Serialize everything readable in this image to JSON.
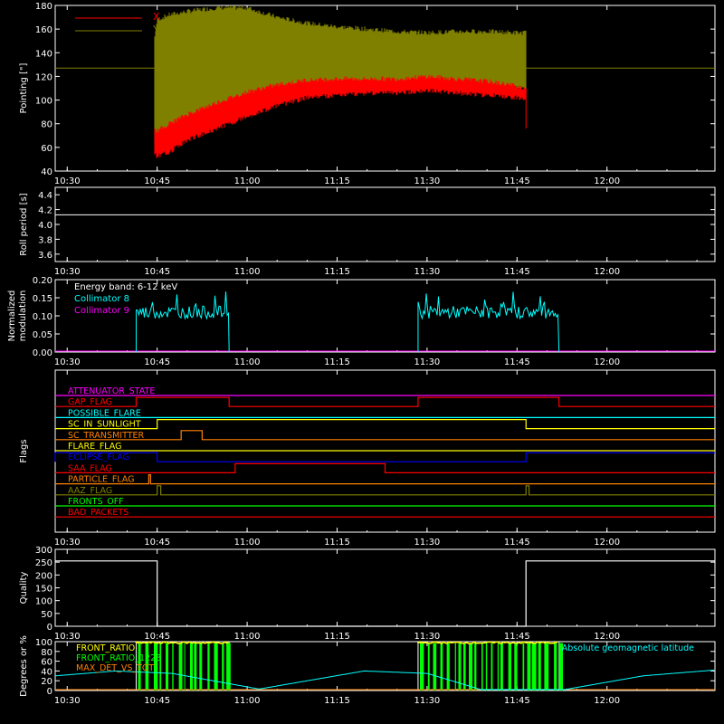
{
  "colors": {
    "background": "#000000",
    "axis": "#ffffff",
    "x_pointing": "#ff0000",
    "y_pointing": "#808000",
    "collimator8": "#00ffff",
    "collimator9": "#ff00ff",
    "quality": "#ffffff",
    "front_ratio": "#ffff00",
    "front_ratio_1223": "#00ff00",
    "max_det_vs_tot": "#ff8000",
    "geomag": "#00ffff"
  },
  "time_ticks": [
    "10:30",
    "10:45",
    "11:00",
    "11:15",
    "11:30",
    "11:45",
    "12:00"
  ],
  "time_tick_minutes": [
    630,
    645,
    660,
    675,
    690,
    705,
    720
  ],
  "time_range": [
    628,
    738
  ],
  "chart_data": [
    {
      "type": "area",
      "name": "pointing",
      "ylabel": "Pointing [\"]",
      "ylim": [
        40,
        180
      ],
      "yticks": [
        "40",
        "60",
        "80",
        "100",
        "120",
        "140",
        "160",
        "180"
      ],
      "legend": [
        "X",
        "Y"
      ],
      "legend_placement": "top-left",
      "active_range": [
        644.5,
        706.5
      ],
      "y_reference_line": 127,
      "series": [
        {
          "name": "Y",
          "x": [
            644.5,
            645,
            647,
            650,
            655,
            660,
            665,
            670,
            675,
            680,
            685,
            690,
            695,
            700,
            705,
            706.5
          ],
          "low": [
            68,
            60,
            68,
            78,
            88,
            97,
            104,
            110,
            112,
            114,
            114,
            116,
            114,
            114,
            112,
            112
          ],
          "high": [
            150,
            168,
            172,
            175,
            178,
            178,
            170,
            165,
            162,
            160,
            158,
            157,
            158,
            158,
            157,
            157
          ]
        },
        {
          "name": "X",
          "x": [
            644.5,
            645,
            647,
            650,
            655,
            660,
            665,
            670,
            675,
            680,
            685,
            690,
            695,
            700,
            705,
            706.5
          ],
          "low": [
            58,
            54,
            58,
            68,
            78,
            88,
            97,
            104,
            106,
            108,
            108,
            110,
            108,
            106,
            104,
            102
          ],
          "high": [
            75,
            74,
            80,
            88,
            98,
            107,
            113,
            117,
            118,
            118,
            118,
            120,
            118,
            116,
            112,
            110
          ]
        }
      ]
    },
    {
      "type": "line",
      "name": "roll_period",
      "ylabel": "Roll period [s]",
      "ylim": [
        3.5,
        4.5
      ],
      "yticks": [
        "3.6",
        "3.8",
        "4.0",
        "4.2",
        "4.4"
      ],
      "series": [
        {
          "name": "",
          "x": [
            628,
            738
          ],
          "values": [
            4.13,
            4.13
          ]
        }
      ]
    },
    {
      "type": "line",
      "name": "modulation",
      "ylabel": "Normalized modulation",
      "ylim": [
        0,
        0.2
      ],
      "yticks": [
        "0.00",
        "0.05",
        "0.10",
        "0.15",
        "0.20"
      ],
      "legend": [
        "Energy band: 6-12 keV",
        "Collimator 8",
        "Collimator 9"
      ],
      "series": [
        {
          "name": "Collimator 8",
          "segments": [
            [
              641.5,
              657
            ],
            [
              688.5,
              712
            ]
          ],
          "level": 0.11
        },
        {
          "name": "Collimator 9",
          "x": [
            628,
            738
          ],
          "values": [
            0,
            0
          ]
        }
      ]
    },
    {
      "type": "line",
      "name": "flags",
      "ylabel": "Flags",
      "flags": [
        {
          "label": "ATTENUATOR_STATE",
          "color": "#ff00ff",
          "steps": []
        },
        {
          "label": "GAP_FLAG",
          "color": "#ff0000",
          "steps": [
            [
              641.5,
              1
            ],
            [
              657,
              0
            ],
            [
              688.5,
              1
            ],
            [
              712,
              0
            ]
          ]
        },
        {
          "label": "POSSIBLE_FLARE",
          "color": "#00ffff",
          "steps": []
        },
        {
          "label": "SC_IN_SUNLIGHT",
          "color": "#ffff00",
          "steps": [
            [
              645,
              1
            ],
            [
              706.5,
              0
            ]
          ]
        },
        {
          "label": "SC_TRANSMITTER",
          "color": "#ff8000",
          "steps": [
            [
              645,
              0
            ],
            [
              649,
              1
            ],
            [
              652.5,
              0
            ]
          ]
        },
        {
          "label": "FLARE_FLAG",
          "color": "#ffff00",
          "steps": []
        },
        {
          "label": "ECLIPSE_FLAG",
          "color": "#0000ff",
          "steps": [
            [
              628,
              1
            ],
            [
              645,
              0
            ],
            [
              706.5,
              1
            ]
          ]
        },
        {
          "label": "SAA_FLAG",
          "color": "#ff0000",
          "steps": [
            [
              658,
              1
            ],
            [
              683,
              0
            ]
          ]
        },
        {
          "label": "PARTICLE_FLAG",
          "color": "#ff8000",
          "steps": [
            [
              643.6,
              1
            ],
            [
              643.9,
              0
            ]
          ]
        },
        {
          "label": "AAZ_FLAG",
          "color": "#808000",
          "steps": [
            [
              645,
              1
            ],
            [
              645.6,
              0
            ],
            [
              706.5,
              1
            ],
            [
              707,
              0
            ]
          ]
        },
        {
          "label": "FRONTS_OFF",
          "color": "#00ff00",
          "steps": []
        },
        {
          "label": "BAD_PACKETS",
          "color": "#ff0000",
          "steps": []
        }
      ]
    },
    {
      "type": "line",
      "name": "quality",
      "ylabel": "Quality",
      "ylim": [
        0,
        300
      ],
      "yticks": [
        "0",
        "50",
        "100",
        "150",
        "200",
        "250",
        "300"
      ],
      "series": [
        {
          "name": "",
          "x": [
            628,
            645,
            645,
            706.5,
            706.5,
            738
          ],
          "values": [
            255,
            255,
            0,
            0,
            255,
            255
          ]
        }
      ]
    },
    {
      "type": "line",
      "name": "ratios",
      "ylabel": "Degrees or %",
      "ylim": [
        0,
        100
      ],
      "yticks": [
        "0",
        "20",
        "40",
        "60",
        "80",
        "100"
      ],
      "legend": [
        "FRONT_RATIO",
        "FRONT_RATIO_1223",
        "MAX_DET_VS_TOT",
        "Absolute geomagnetic latitude"
      ],
      "active_segments": [
        [
          641.5,
          657
        ],
        [
          688.5,
          712
        ]
      ],
      "series": [
        {
          "name": "Absolute geomagnetic latitude",
          "x": [
            628,
            638,
            647.5,
            662,
            679.5,
            690,
            699,
            713,
            726,
            738
          ],
          "values": [
            30,
            40,
            35,
            3,
            40,
            35,
            2,
            2,
            30,
            42
          ]
        }
      ]
    }
  ]
}
